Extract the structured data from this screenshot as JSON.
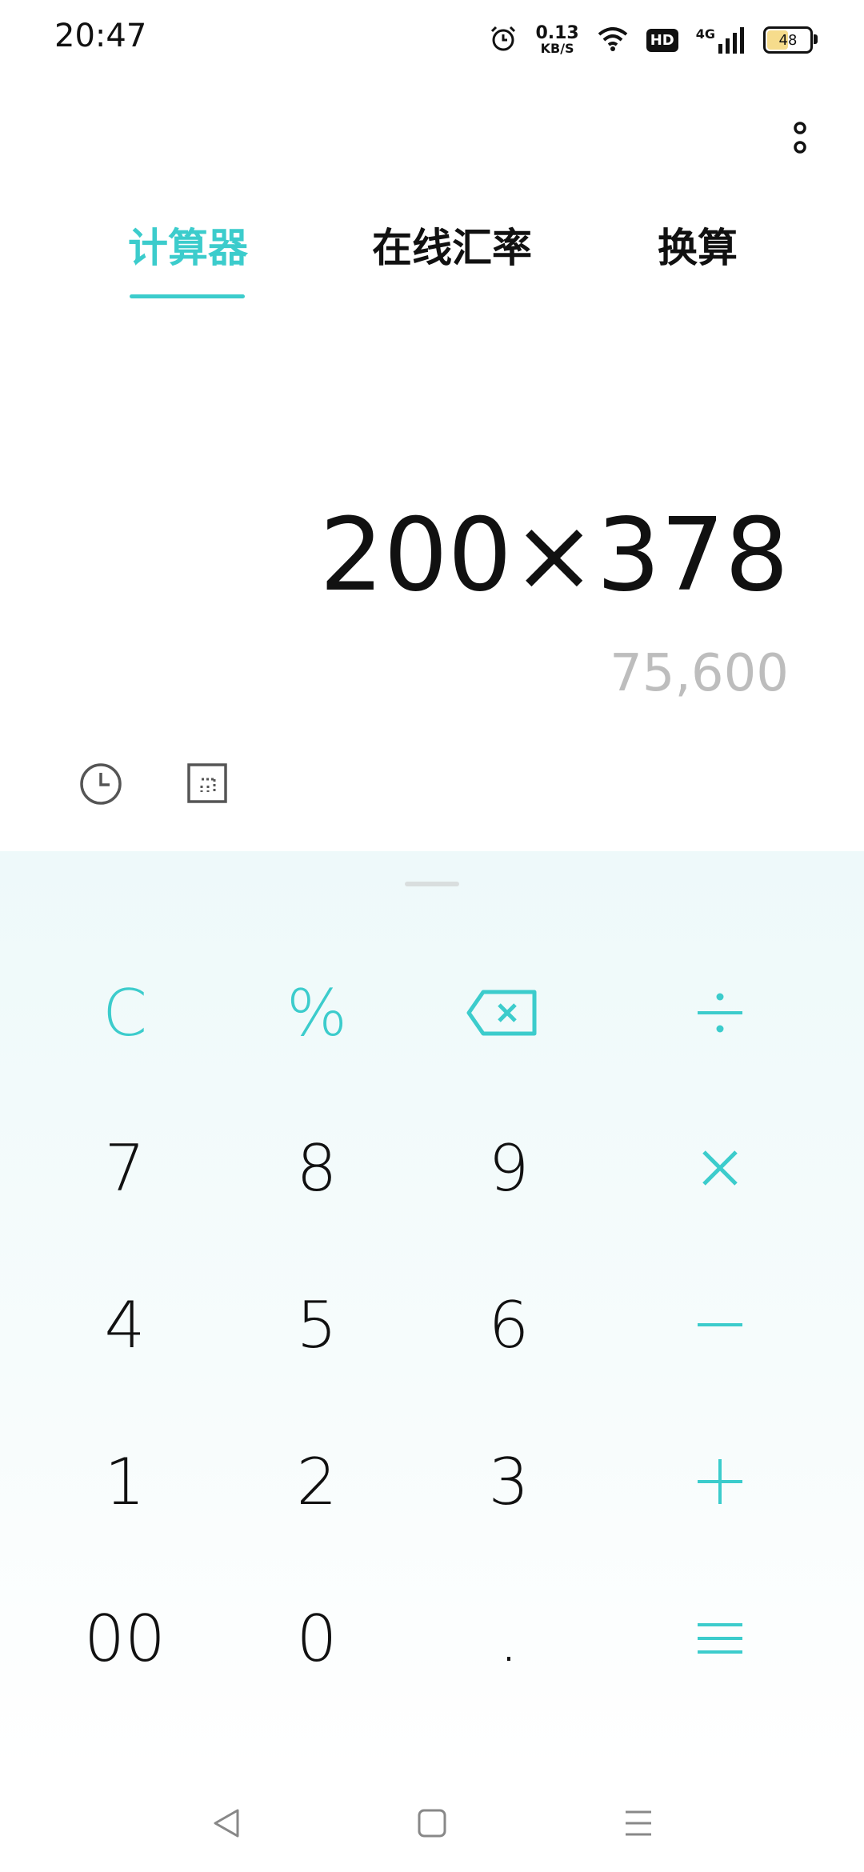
{
  "status_bar": {
    "time": "20:47",
    "net_speed_value": "0.13",
    "net_speed_unit": "KB/S",
    "hd_label": "HD",
    "network_label": "4G",
    "battery_level": "48",
    "icons": [
      "alarm-icon",
      "wifi-icon",
      "signal-icon",
      "battery-icon"
    ]
  },
  "tabs": [
    {
      "label": "计算器",
      "active": true
    },
    {
      "label": "在线汇率",
      "active": false
    },
    {
      "label": "换算",
      "active": false
    }
  ],
  "display": {
    "expression": "200×378",
    "result": "75,600"
  },
  "tools": [
    "history-icon",
    "scientific-mode-icon"
  ],
  "keypad": {
    "rows": [
      [
        "C",
        "%",
        "backspace",
        "÷"
      ],
      [
        "7",
        "8",
        "9",
        "×"
      ],
      [
        "4",
        "5",
        "6",
        "−"
      ],
      [
        "1",
        "2",
        "3",
        "+"
      ],
      [
        "00",
        "0",
        ".",
        "="
      ]
    ],
    "labels": {
      "clear": "C",
      "percent": "%",
      "k7": "7",
      "k8": "8",
      "k9": "9",
      "k4": "4",
      "k5": "5",
      "k6": "6",
      "k1": "1",
      "k2": "2",
      "k3": "3",
      "k00": "00",
      "k0": "0",
      "dot": "."
    }
  },
  "colors": {
    "accent": "#3ccccc",
    "result_text": "#bdbdbd",
    "keypad_background": "#eef9fa",
    "battery_fill": "#f6dc8c"
  },
  "nav_bar": [
    "back-icon",
    "home-icon",
    "recents-icon"
  ]
}
